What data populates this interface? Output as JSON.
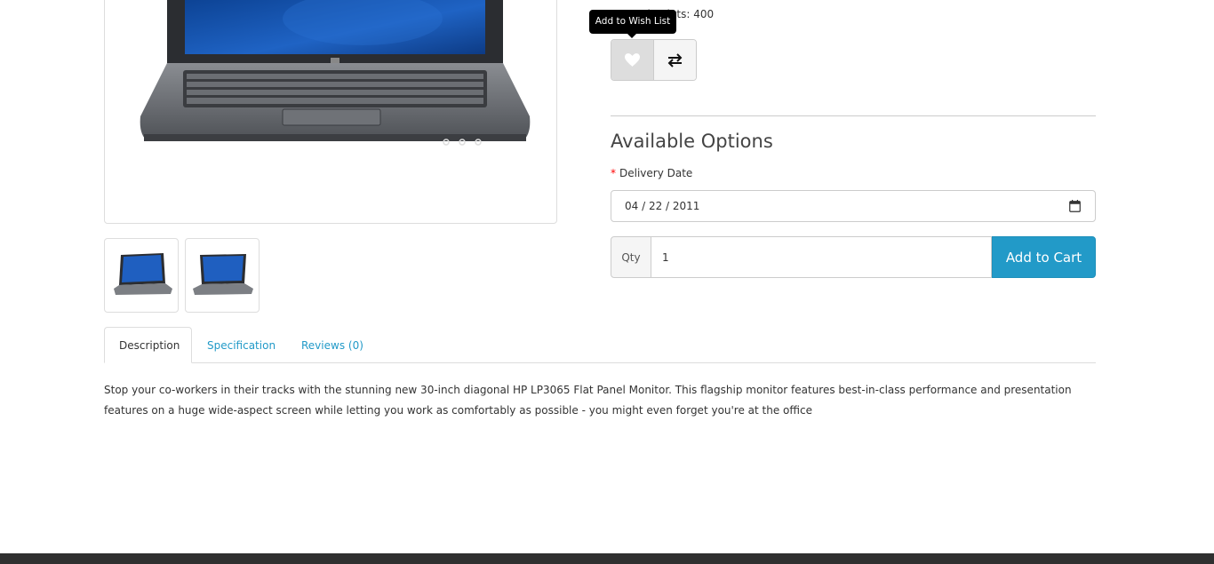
{
  "product": {
    "reward_points": "Reward points: 400",
    "tooltip": "Add to Wish List",
    "icons": {
      "wishlist": "heart-icon",
      "compare": "exchange-icon",
      "calendar": "calendar-icon"
    }
  },
  "options": {
    "title": "Available Options",
    "delivery_label": "Delivery Date",
    "required_mark": "*",
    "delivery_value": "04 / 22 / 2011"
  },
  "cart": {
    "qty_label": "Qty",
    "qty_value": "1",
    "add_label": "Add to Cart"
  },
  "tabs": [
    {
      "label": "Description"
    },
    {
      "label": "Specification"
    },
    {
      "label": "Reviews (0)"
    }
  ],
  "description": "Stop your co-workers in their tracks with the stunning new 30-inch diagonal HP LP3065 Flat Panel Monitor. This flagship monitor features best-in-class performance and presentation features on a huge wide-aspect screen while letting you work as comfortably as possible - you might even forget you're at the office",
  "colors": {
    "accent": "#229ac8",
    "tooltip_bg": "#000000",
    "footer": "#303030"
  }
}
